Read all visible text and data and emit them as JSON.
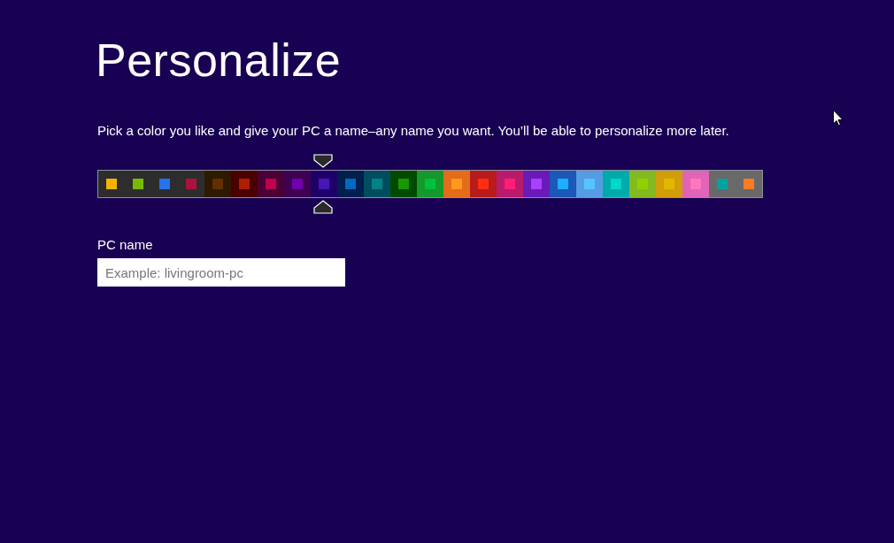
{
  "title": "Personalize",
  "description": "Pick a color you like and give your PC a name–any name you want. You’ll be able to personalize more later.",
  "swatches": [
    {
      "tile": {
        "color": "#2d2d2d"
      },
      "color": "#f4b300",
      "selected": false
    },
    {
      "tile": {
        "color": "#2d2d2d"
      },
      "color": "#78ba00",
      "selected": false
    },
    {
      "tile": {
        "color": "#2d2d2d"
      },
      "color": "#2673ec",
      "selected": false
    },
    {
      "tile": {
        "color": "#2d2d2d"
      },
      "color": "#ae113d",
      "selected": false
    },
    {
      "tile": {
        "color": "#2d1a00"
      },
      "color": "#632f00",
      "selected": false
    },
    {
      "tile": {
        "color": "#4a0000"
      },
      "color": "#b01e00",
      "selected": false
    },
    {
      "tile": {
        "color": "#4a0035"
      },
      "color": "#c1004f",
      "selected": false
    },
    {
      "tile": {
        "color": "#3e0050"
      },
      "color": "#7200ac",
      "selected": false
    },
    {
      "tile": {
        "color": "#1f0068"
      },
      "color": "#4617b4",
      "selected": true
    },
    {
      "tile": {
        "color": "#001e4e"
      },
      "color": "#006ac1",
      "selected": false
    },
    {
      "tile": {
        "color": "#004d60"
      },
      "color": "#008287",
      "selected": false
    },
    {
      "tile": {
        "color": "#004a00"
      },
      "color": "#199900",
      "selected": false
    },
    {
      "tile": {
        "color": "#15992a"
      },
      "color": "#00c13f",
      "selected": false
    },
    {
      "tile": {
        "color": "#e56c19"
      },
      "color": "#ff981d",
      "selected": false
    },
    {
      "tile": {
        "color": "#b81b1b"
      },
      "color": "#ff2e12",
      "selected": false
    },
    {
      "tile": {
        "color": "#b81b6c"
      },
      "color": "#ff1d77",
      "selected": false
    },
    {
      "tile": {
        "color": "#691bb8"
      },
      "color": "#aa40ff",
      "selected": false
    },
    {
      "tile": {
        "color": "#1b58b8"
      },
      "color": "#1faeff",
      "selected": false
    },
    {
      "tile": {
        "color": "#569ce3"
      },
      "color": "#56c5ff",
      "selected": false
    },
    {
      "tile": {
        "color": "#00aaaa"
      },
      "color": "#00d8cc",
      "selected": false
    },
    {
      "tile": {
        "color": "#83ba1f"
      },
      "color": "#91d100",
      "selected": false
    },
    {
      "tile": {
        "color": "#d39d09"
      },
      "color": "#e1b700",
      "selected": false
    },
    {
      "tile": {
        "color": "#e064b7"
      },
      "color": "#ff76bc",
      "selected": false
    },
    {
      "tile": {
        "color": "#696969"
      },
      "color": "#00a3a3",
      "selected": false
    },
    {
      "tile": {
        "color": "#696969"
      },
      "color": "#fe7c22",
      "selected": false
    }
  ],
  "pc_name": {
    "label": "PC name",
    "placeholder": "Example: livingroom-pc"
  }
}
